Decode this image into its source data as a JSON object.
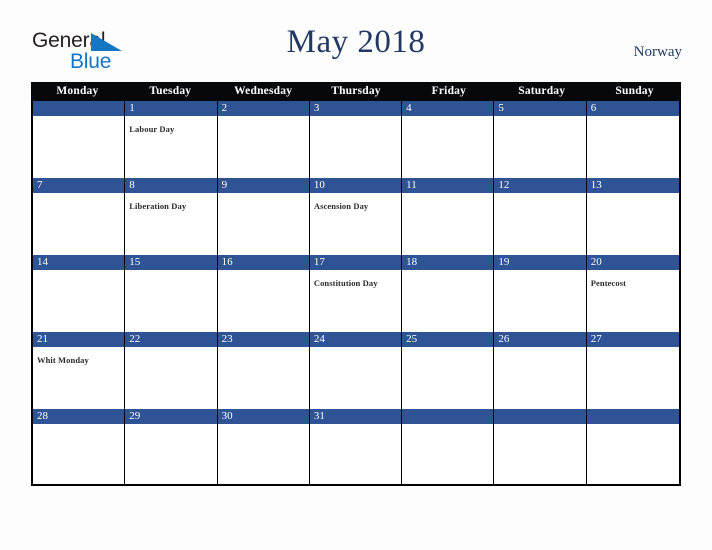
{
  "brand": {
    "name_part1": "General",
    "name_part2": "Blue",
    "logo_icon": "blue-triangle-icon",
    "color_dark": "#231f20",
    "color_blue": "#1577c4"
  },
  "header": {
    "title": "May 2018",
    "country": "Norway",
    "title_color": "#223a63"
  },
  "calendar": {
    "month": "May",
    "year": "2018",
    "first_day_of_week": "Monday",
    "header_bg": "#07080c",
    "day_bar_bg": "#2e5496",
    "weekday_headers": [
      {
        "label": "Monday"
      },
      {
        "label": "Tuesday"
      },
      {
        "label": "Wednesday"
      },
      {
        "label": "Thursday"
      },
      {
        "label": "Friday"
      },
      {
        "label": "Saturday"
      },
      {
        "label": "Sunday"
      }
    ],
    "weeks": [
      {
        "days": [
          {
            "num": "",
            "event": ""
          },
          {
            "num": "1",
            "event": "Labour Day"
          },
          {
            "num": "2",
            "event": ""
          },
          {
            "num": "3",
            "event": ""
          },
          {
            "num": "4",
            "event": ""
          },
          {
            "num": "5",
            "event": ""
          },
          {
            "num": "6",
            "event": ""
          }
        ]
      },
      {
        "days": [
          {
            "num": "7",
            "event": ""
          },
          {
            "num": "8",
            "event": "Liberation Day"
          },
          {
            "num": "9",
            "event": ""
          },
          {
            "num": "10",
            "event": "Ascension Day"
          },
          {
            "num": "11",
            "event": ""
          },
          {
            "num": "12",
            "event": ""
          },
          {
            "num": "13",
            "event": ""
          }
        ]
      },
      {
        "days": [
          {
            "num": "14",
            "event": ""
          },
          {
            "num": "15",
            "event": ""
          },
          {
            "num": "16",
            "event": ""
          },
          {
            "num": "17",
            "event": "Constitution Day"
          },
          {
            "num": "18",
            "event": ""
          },
          {
            "num": "19",
            "event": ""
          },
          {
            "num": "20",
            "event": "Pentecost"
          }
        ]
      },
      {
        "days": [
          {
            "num": "21",
            "event": "Whit Monday"
          },
          {
            "num": "22",
            "event": ""
          },
          {
            "num": "23",
            "event": ""
          },
          {
            "num": "24",
            "event": ""
          },
          {
            "num": "25",
            "event": ""
          },
          {
            "num": "26",
            "event": ""
          },
          {
            "num": "27",
            "event": ""
          }
        ]
      },
      {
        "days": [
          {
            "num": "28",
            "event": ""
          },
          {
            "num": "29",
            "event": ""
          },
          {
            "num": "30",
            "event": ""
          },
          {
            "num": "31",
            "event": ""
          },
          {
            "num": "",
            "event": ""
          },
          {
            "num": "",
            "event": ""
          },
          {
            "num": "",
            "event": ""
          }
        ]
      }
    ]
  }
}
